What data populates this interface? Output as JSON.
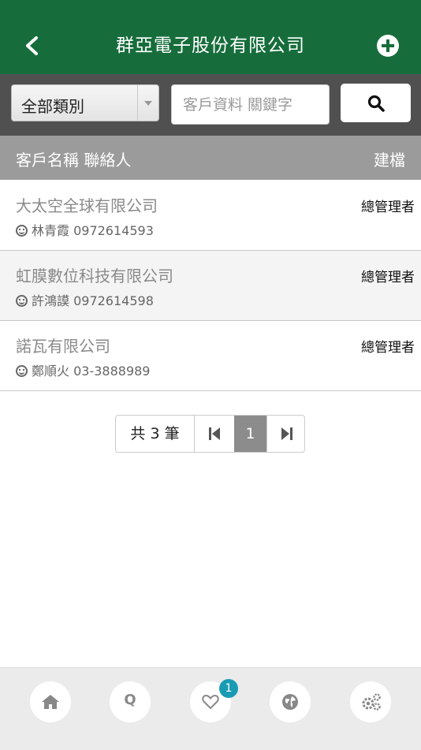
{
  "header": {
    "title": "群亞電子股份有限公司",
    "back_icon": "chevron-left-icon",
    "add_icon": "plus-circle-icon"
  },
  "filter": {
    "category": "全部類別",
    "search_placeholder": "客戶資料 關鍵字",
    "search_icon": "search-icon"
  },
  "columns": {
    "left": "客戶名稱 聯絡人",
    "right": "建檔"
  },
  "customers": [
    {
      "name": "大太空全球有限公司",
      "contact": "林青霞 0972614593",
      "role": "總管理者"
    },
    {
      "name": "虹膜數位科技有限公司",
      "contact": "許鴻謨 0972614598",
      "role": "總管理者"
    },
    {
      "name": "諾瓦有限公司",
      "contact": "鄭順火 03-3888989",
      "role": "總管理者"
    }
  ],
  "pagination": {
    "total": "共 3 筆",
    "current": "1"
  },
  "tabbar": {
    "items": [
      "home-icon",
      "q-icon",
      "heart-icon",
      "globe-icon",
      "gears-icon"
    ],
    "q_label": "Q",
    "badge": "1"
  },
  "colors": {
    "header": "#166d3b",
    "toolbar": "#505050",
    "column_header": "#9b9b9b",
    "badge": "#1a9bb4"
  }
}
